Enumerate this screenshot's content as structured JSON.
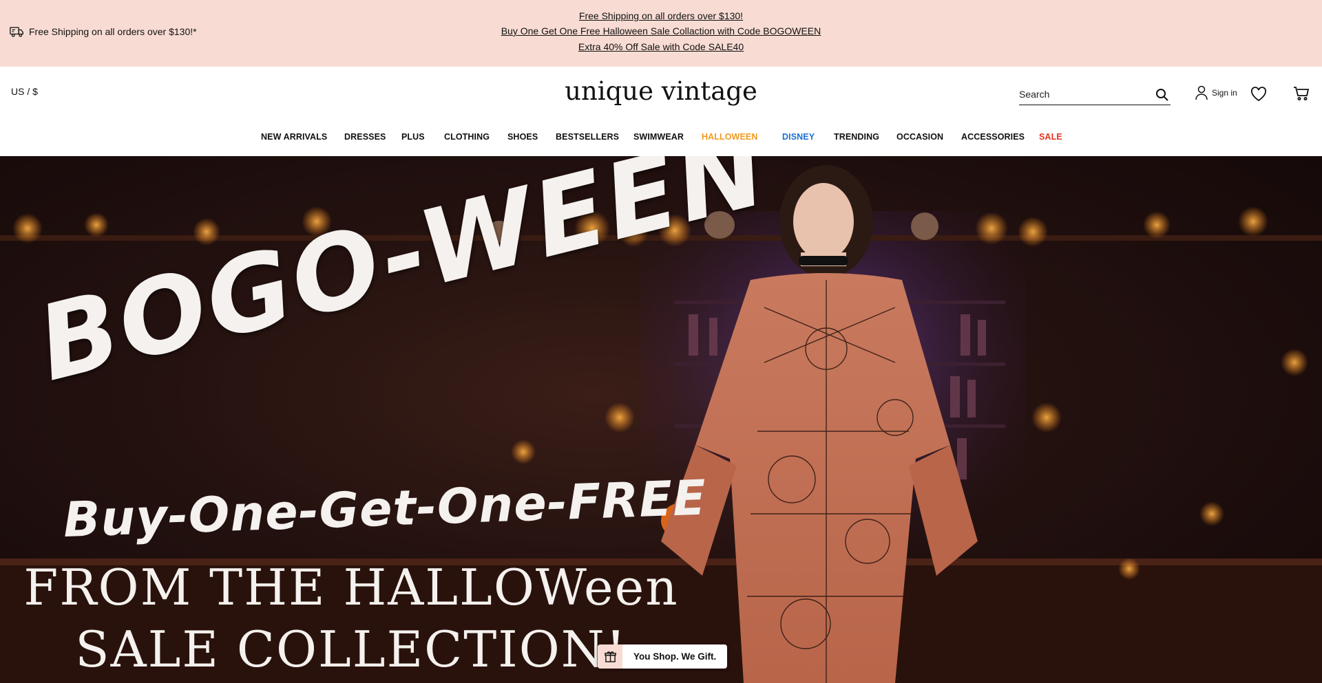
{
  "announcement": {
    "left_text": "Free Shipping on all orders over $130!*",
    "promos": [
      "Free Shipping on all orders over $130!",
      "Buy One Get One Free Halloween Sale Collaction with Code BOGOWEEN",
      "Extra 40% Off Sale with Code SALE40"
    ],
    "background_color": "#f8dcd3"
  },
  "header": {
    "locale": "US / $",
    "logo": "unique vintage",
    "search": {
      "placeholder": "Search"
    },
    "signin_label": "Sign in"
  },
  "nav": {
    "items": [
      {
        "label": "NEW ARRIVALS",
        "color": "#111111"
      },
      {
        "label": "DRESSES",
        "color": "#111111"
      },
      {
        "label": "PLUS",
        "color": "#111111"
      },
      {
        "label": "CLOTHING",
        "color": "#111111"
      },
      {
        "label": "SHOES",
        "color": "#111111"
      },
      {
        "label": "BESTSELLERS",
        "color": "#111111"
      },
      {
        "label": "SWIMWEAR",
        "color": "#111111"
      },
      {
        "label": "HALLOWEEN",
        "color": "#f29a1f"
      },
      {
        "label": "DISNEY",
        "color": "#1c6fd1"
      },
      {
        "label": "TRENDING",
        "color": "#111111"
      },
      {
        "label": "OCCASION",
        "color": "#111111"
      },
      {
        "label": "ACCESSORIES",
        "color": "#111111"
      },
      {
        "label": "SALE",
        "color": "#e5321e"
      }
    ]
  },
  "hero": {
    "title": "BOGO-WEEN",
    "subtitle": "Buy-One-Get-One-FREE",
    "line2": "FROM THE HALLOWeen",
    "line3": "SALE COLLECTION!"
  },
  "gift_widget": {
    "label": "You Shop. We Gift."
  }
}
